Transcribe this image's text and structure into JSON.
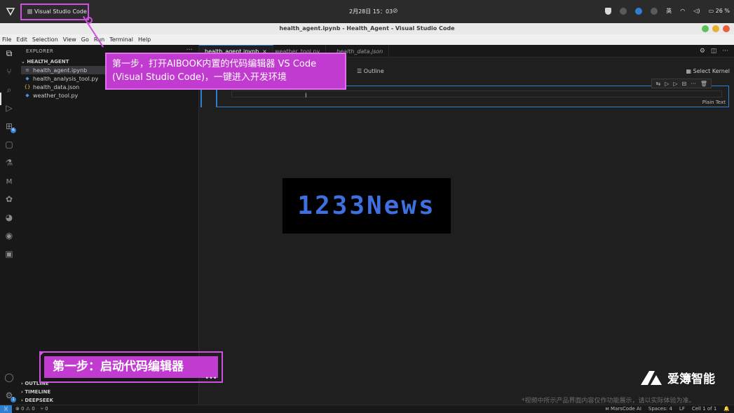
{
  "os": {
    "app_name": "Visual Studio Code",
    "clock": "2月28日 15：03",
    "input_method": "英",
    "battery": "26 %"
  },
  "window": {
    "title": "health_agent.ipynb - Health_Agent - Visual Studio Code"
  },
  "menu": [
    "File",
    "Edit",
    "Selection",
    "View",
    "Go",
    "Run",
    "Terminal",
    "Help"
  ],
  "sidebar": {
    "header": "EXPLORER",
    "folder": "HEALTH_AGENT",
    "files": [
      {
        "icon": "≡",
        "name": "health_agent.ipynb"
      },
      {
        "icon": "◆",
        "name": "health_analysis_tool.py"
      },
      {
        "icon": "{}",
        "name": "health_data.json"
      },
      {
        "icon": "◆",
        "name": "weather_tool.py"
      }
    ],
    "sections": [
      "OUTLINE",
      "TIMELINE",
      "DEEPSEEK"
    ],
    "extensions_badge": "6",
    "accounts_badge": "1"
  },
  "editor": {
    "tabs": [
      {
        "label": "health_agent.ipynb",
        "active": true
      },
      {
        "label": "weather_tool.py",
        "active": false
      },
      {
        "label": "health_data.json",
        "active": false
      }
    ],
    "toolbar_partial": "s",
    "outline_label": "Outline",
    "kernel_label": "Select Kernel",
    "cell_language": "Plain Text"
  },
  "watermark": "1233News",
  "status": {
    "problems": "0 ⚠ 0",
    "ports": "0",
    "marscode": "MarsCode AI",
    "spaces": "Spaces: 4",
    "eol": "LF",
    "cell": "Cell 1 of 1"
  },
  "annotations": {
    "top_line1": "第一步，打开AIBOOK内置的代码编辑器 VS Code",
    "top_line2": "(Visual Studio Code)，一键进入开发环境",
    "bottom": "第一步：启动代码编辑器"
  },
  "brand": {
    "name": "爱簿智能",
    "disclaimer": "*视频中所示产品界面内容仅作功能展示，请以实际体验为准。"
  },
  "colors": {
    "accent": "#2f7fd1",
    "callout": "#c23bd0",
    "callout_border": "#d050e0"
  }
}
